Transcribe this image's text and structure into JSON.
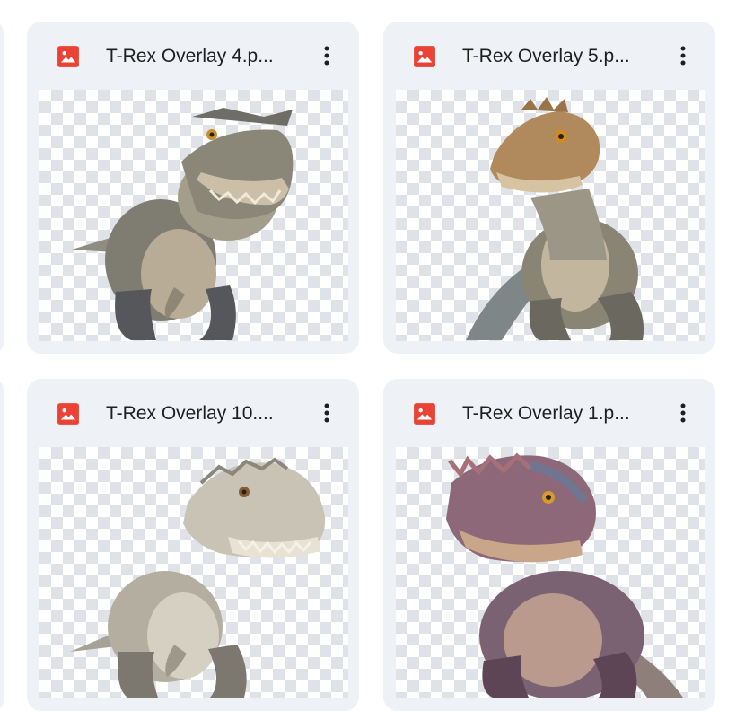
{
  "files": [
    {
      "name": "T-Rex Overlay 4.p...",
      "file_type_icon": "image-file-icon",
      "menu_icon": "more-vert-icon"
    },
    {
      "name": "T-Rex Overlay 5.p...",
      "file_type_icon": "image-file-icon",
      "menu_icon": "more-vert-icon"
    },
    {
      "name": "T-Rex Overlay 10....",
      "file_type_icon": "image-file-icon",
      "menu_icon": "more-vert-icon"
    },
    {
      "name": "T-Rex Overlay 1.p...",
      "file_type_icon": "image-file-icon",
      "menu_icon": "more-vert-icon"
    }
  ],
  "colors": {
    "card_background": "#eef1f6",
    "image_icon_red": "#ea4335",
    "text_primary": "#1f1f1f",
    "checker_light": "#ffffff",
    "checker_dark": "#dfe3e8"
  }
}
